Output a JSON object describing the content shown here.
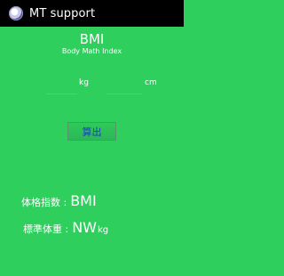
{
  "window": {
    "title": "MT support",
    "icon": "app-logo-icon"
  },
  "main": {
    "title": "BMI",
    "subtitle": "Body Math Index",
    "weight": {
      "value": "",
      "unit": "kg"
    },
    "height": {
      "value": "",
      "unit": "cm"
    },
    "calculate_label": "算出",
    "results": {
      "bmi_label": "体格指数 :",
      "bmi_value": "BMI",
      "standard_weight_label": "標準体重 :",
      "standard_weight_value": "NW",
      "standard_weight_unit": "kg"
    }
  },
  "colors": {
    "background": "#2fcf5e",
    "titlebar": "#000000",
    "button_text": "#1d3cc8"
  }
}
